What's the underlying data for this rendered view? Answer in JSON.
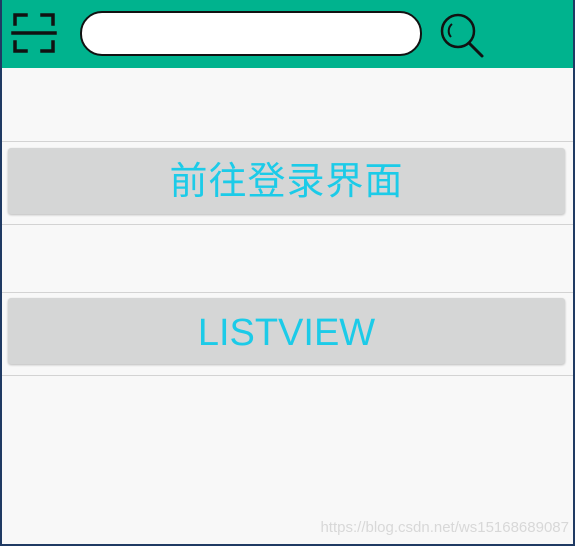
{
  "toolbar": {
    "scan_icon": "scan-icon",
    "search": {
      "value": "",
      "placeholder": ""
    },
    "search_icon": "search-icon",
    "background_color": "#00b38e"
  },
  "main": {
    "login_button_label": "前往登录界面",
    "listview_button_label": "LISTVIEW",
    "button_text_color": "#1ccbe8",
    "button_background_color": "#d5d6d6"
  },
  "watermark": "https://blog.csdn.net/ws15168689087"
}
